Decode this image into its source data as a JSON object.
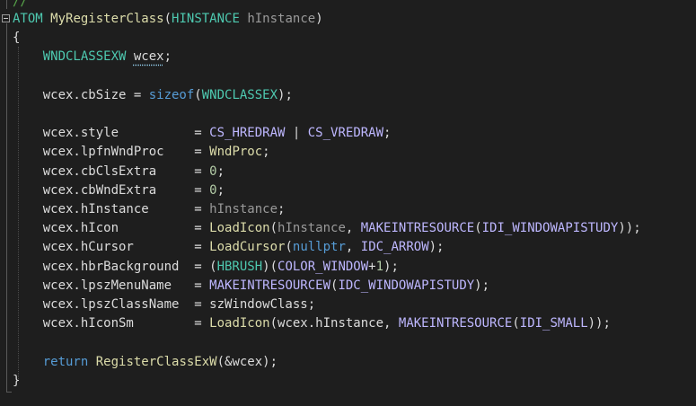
{
  "comment": "//",
  "lines": [
    {
      "tokens": [
        {
          "t": "type",
          "v": "ATOM"
        },
        {
          "t": "punc",
          "v": " "
        },
        {
          "t": "fn",
          "v": "MyRegisterClass"
        },
        {
          "t": "punc",
          "v": "("
        },
        {
          "t": "type",
          "v": "HINSTANCE"
        },
        {
          "t": "punc",
          "v": " "
        },
        {
          "t": "param",
          "v": "hInstance"
        },
        {
          "t": "punc",
          "v": ")"
        }
      ]
    },
    {
      "tokens": [
        {
          "t": "punc",
          "v": "{"
        }
      ]
    },
    {
      "tokens": [
        {
          "t": "punc",
          "v": "    "
        },
        {
          "t": "type",
          "v": "WNDCLASSEXW"
        },
        {
          "t": "punc",
          "v": " "
        },
        {
          "t": "squig",
          "v": "wcex"
        },
        {
          "t": "punc",
          "v": ";"
        }
      ]
    },
    {
      "tokens": []
    },
    {
      "tokens": [
        {
          "t": "punc",
          "v": "    wcex.cbSize = "
        },
        {
          "t": "kw",
          "v": "sizeof"
        },
        {
          "t": "punc",
          "v": "("
        },
        {
          "t": "type",
          "v": "WNDCLASSEX"
        },
        {
          "t": "punc",
          "v": ");"
        }
      ]
    },
    {
      "tokens": []
    },
    {
      "tokens": [
        {
          "t": "punc",
          "v": "    wcex.style          = "
        },
        {
          "t": "macro",
          "v": "CS_HREDRAW"
        },
        {
          "t": "punc",
          "v": " | "
        },
        {
          "t": "macro",
          "v": "CS_VREDRAW"
        },
        {
          "t": "punc",
          "v": ";"
        }
      ]
    },
    {
      "tokens": [
        {
          "t": "punc",
          "v": "    wcex.lpfnWndProc    = "
        },
        {
          "t": "fn",
          "v": "WndProc"
        },
        {
          "t": "punc",
          "v": ";"
        }
      ]
    },
    {
      "tokens": [
        {
          "t": "punc",
          "v": "    wcex.cbClsExtra     = "
        },
        {
          "t": "num",
          "v": "0"
        },
        {
          "t": "punc",
          "v": ";"
        }
      ]
    },
    {
      "tokens": [
        {
          "t": "punc",
          "v": "    wcex.cbWndExtra     = "
        },
        {
          "t": "num",
          "v": "0"
        },
        {
          "t": "punc",
          "v": ";"
        }
      ]
    },
    {
      "tokens": [
        {
          "t": "punc",
          "v": "    wcex.hInstance      = "
        },
        {
          "t": "param",
          "v": "hInstance"
        },
        {
          "t": "punc",
          "v": ";"
        }
      ]
    },
    {
      "tokens": [
        {
          "t": "punc",
          "v": "    wcex.hIcon          = "
        },
        {
          "t": "fn",
          "v": "LoadIcon"
        },
        {
          "t": "punc",
          "v": "("
        },
        {
          "t": "param",
          "v": "hInstance"
        },
        {
          "t": "punc",
          "v": ", "
        },
        {
          "t": "macro",
          "v": "MAKEINTRESOURCE"
        },
        {
          "t": "punc",
          "v": "("
        },
        {
          "t": "macro",
          "v": "IDI_WINDOWAPISTUDY"
        },
        {
          "t": "punc",
          "v": "));"
        }
      ]
    },
    {
      "tokens": [
        {
          "t": "punc",
          "v": "    wcex.hCursor        = "
        },
        {
          "t": "fn",
          "v": "LoadCursor"
        },
        {
          "t": "punc",
          "v": "("
        },
        {
          "t": "kw",
          "v": "nullptr"
        },
        {
          "t": "punc",
          "v": ", "
        },
        {
          "t": "macro",
          "v": "IDC_ARROW"
        },
        {
          "t": "punc",
          "v": ");"
        }
      ]
    },
    {
      "tokens": [
        {
          "t": "punc",
          "v": "    wcex.hbrBackground  = ("
        },
        {
          "t": "type",
          "v": "HBRUSH"
        },
        {
          "t": "punc",
          "v": ")("
        },
        {
          "t": "macro",
          "v": "COLOR_WINDOW"
        },
        {
          "t": "punc",
          "v": "+"
        },
        {
          "t": "num",
          "v": "1"
        },
        {
          "t": "punc",
          "v": ");"
        }
      ]
    },
    {
      "tokens": [
        {
          "t": "punc",
          "v": "    wcex.lpszMenuName   = "
        },
        {
          "t": "macro",
          "v": "MAKEINTRESOURCEW"
        },
        {
          "t": "punc",
          "v": "("
        },
        {
          "t": "macro",
          "v": "IDC_WINDOWAPISTUDY"
        },
        {
          "t": "punc",
          "v": ");"
        }
      ]
    },
    {
      "tokens": [
        {
          "t": "punc",
          "v": "    wcex.lpszClassName  = szWindowClass;"
        }
      ]
    },
    {
      "tokens": [
        {
          "t": "punc",
          "v": "    wcex.hIconSm        = "
        },
        {
          "t": "fn",
          "v": "LoadIcon"
        },
        {
          "t": "punc",
          "v": "(wcex.hInstance, "
        },
        {
          "t": "macro",
          "v": "MAKEINTRESOURCE"
        },
        {
          "t": "punc",
          "v": "("
        },
        {
          "t": "macro",
          "v": "IDI_SMALL"
        },
        {
          "t": "punc",
          "v": "));"
        }
      ]
    },
    {
      "tokens": []
    },
    {
      "tokens": [
        {
          "t": "punc",
          "v": "    "
        },
        {
          "t": "kw",
          "v": "return"
        },
        {
          "t": "punc",
          "v": " "
        },
        {
          "t": "fn",
          "v": "RegisterClassExW"
        },
        {
          "t": "punc",
          "v": "(&wcex);"
        }
      ]
    },
    {
      "tokens": [
        {
          "t": "punc",
          "v": "}"
        }
      ]
    }
  ],
  "colors": {
    "background": "#1e1e1e",
    "type": "#4ec9b0",
    "function": "#dcdcaa",
    "macro": "#beb7ff",
    "parameter": "#9a9a9a",
    "keyword": "#569cd6",
    "number": "#b5cea8",
    "comment": "#57a64a"
  }
}
